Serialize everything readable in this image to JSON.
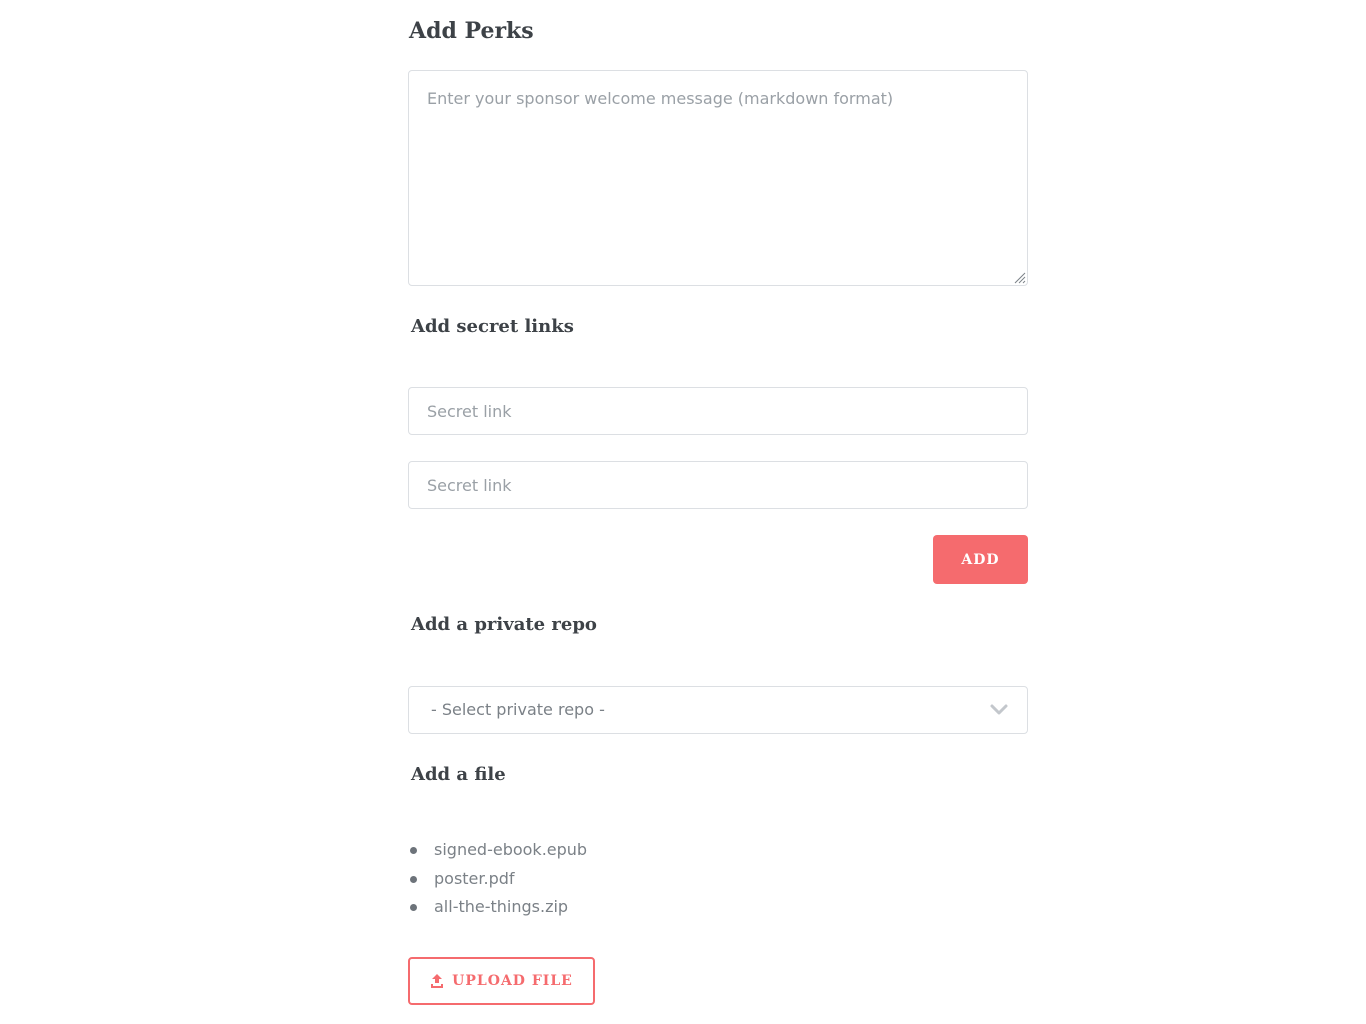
{
  "perks": {
    "title": "Add Perks",
    "message_placeholder": "Enter your sponsor welcome message (markdown format)"
  },
  "secret_links": {
    "title": "Add secret links",
    "inputs": [
      {
        "placeholder": "Secret link",
        "value": ""
      },
      {
        "placeholder": "Secret link",
        "value": ""
      }
    ],
    "add_label": "ADD"
  },
  "private_repo": {
    "title": "Add a private repo",
    "selected": "- Select private repo -",
    "icon": "chevron-down-icon"
  },
  "file": {
    "title": "Add a file",
    "files": [
      "signed-ebook.epub",
      "poster.pdf",
      "all-the-things.zip"
    ],
    "upload_label": "UPLOAD FILE",
    "upload_icon": "upload-icon"
  },
  "colors": {
    "accent": "#f56b6e",
    "border": "#dcdfe3",
    "heading": "#3d4247",
    "muted_text": "#7b8187"
  }
}
